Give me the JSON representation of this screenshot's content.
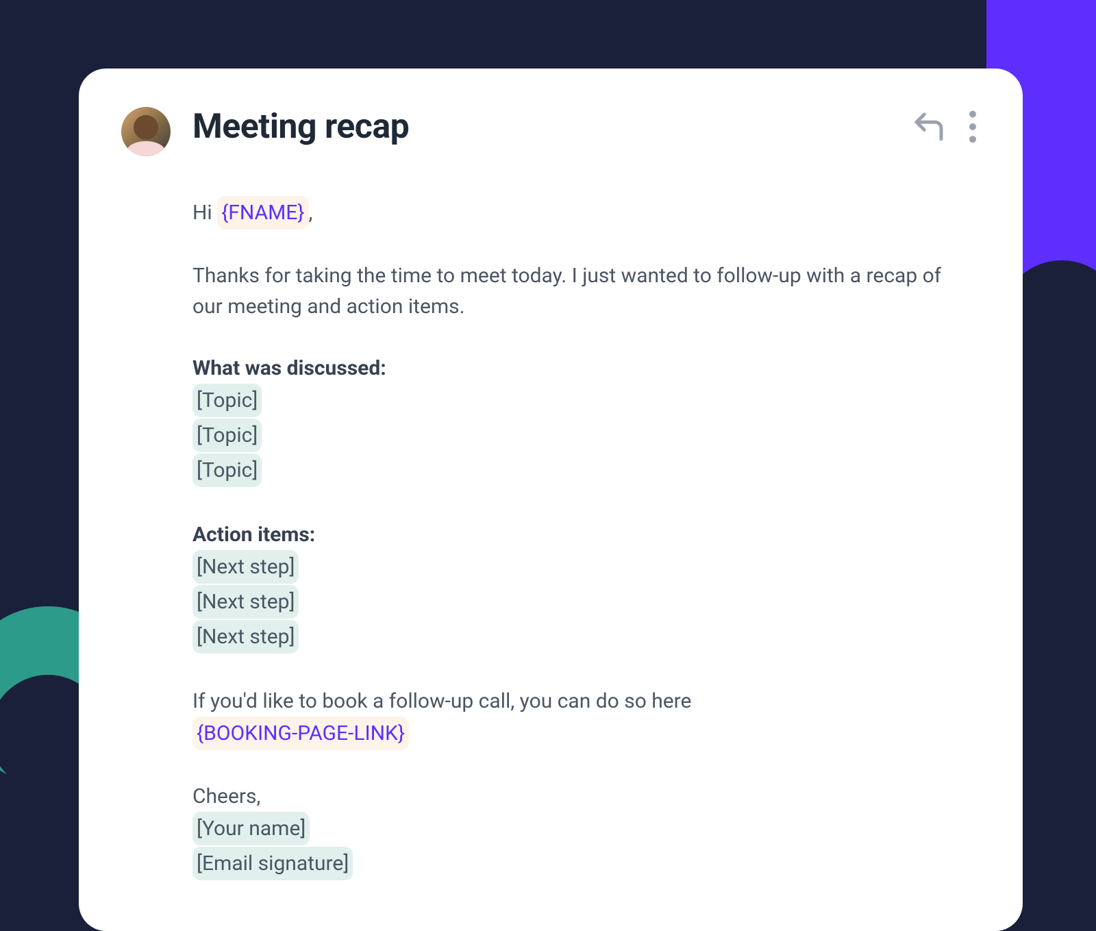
{
  "colors": {
    "background": "#1a1f3a",
    "accent_purple": "#5e2eff",
    "accent_teal": "#2d9b8a",
    "card_bg": "#ffffff",
    "text_heading": "#1f2937",
    "text_body": "#4b5563",
    "merge_tag_bg": "#fef3e8",
    "merge_tag_text": "#5e2eff",
    "placeholder_bg": "#e1f0ec",
    "icon_gray": "#9ca3af"
  },
  "email": {
    "title": "Meeting recap",
    "greeting_prefix": "Hi ",
    "greeting_suffix": ",",
    "fname_tag": "{FNAME}",
    "intro": "Thanks for taking the time to meet today. I just wanted to follow-up with a recap of our meeting and action items.",
    "section1_heading": "What was discussed:",
    "section1_items": [
      "[Topic]",
      "[Topic]",
      "[Topic]"
    ],
    "section2_heading": "Action items:",
    "section2_items": [
      "[Next step]",
      "[Next step]",
      "[Next step]"
    ],
    "followup_text": "If you'd like to book a follow-up call, you can do so here ",
    "booking_tag": "{BOOKING-PAGE-LINK}",
    "signoff": "Cheers,",
    "signature_items": [
      "[Your name]",
      "[Email signature]"
    ]
  },
  "icons": {
    "reply": "reply-icon",
    "more": "more-vertical-icon"
  }
}
